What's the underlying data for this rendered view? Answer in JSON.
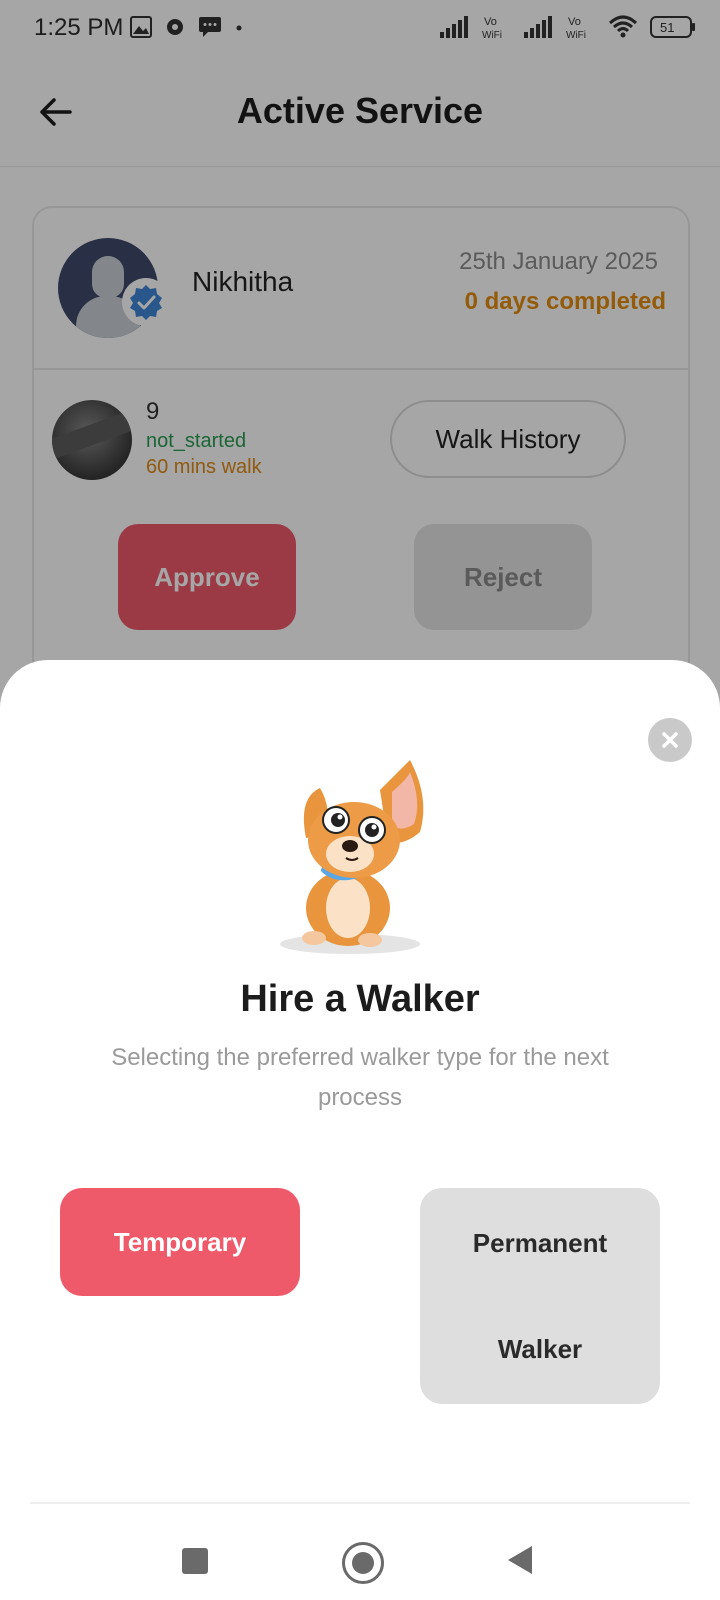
{
  "status_bar": {
    "time": "1:25 PM",
    "icons_left": [
      "photo-icon",
      "settings-icon",
      "message-icon",
      "dot-icon"
    ],
    "icons_right": [
      "signal-icon",
      "vowifi-icon",
      "signal-icon",
      "vowifi-icon",
      "wifi-icon",
      "battery-icon"
    ],
    "battery": "51",
    "vowifi_label_top": "Vo",
    "vowifi_label_bottom": "WiFi"
  },
  "header": {
    "title": "Active Service",
    "back_icon": "arrow-left-icon"
  },
  "service_card": {
    "user_name": "Nikhitha",
    "date": "25th January 2025",
    "days_completed": "0 days completed",
    "pet": {
      "id": "9",
      "status": "not_started",
      "walk_duration": "60 mins walk"
    },
    "walk_history_label": "Walk History",
    "approve_label": "Approve",
    "reject_label": "Reject"
  },
  "sheet": {
    "title": "Hire a Walker",
    "subtitle": "Selecting the preferred walker type for the next process",
    "temporary_label": "Temporary",
    "permanent_label_line1": "Permanent",
    "permanent_label_line2": "Walker",
    "close_icon": "close-icon",
    "illustration": "dog-illustration"
  },
  "colors": {
    "accent": "#ef5a6b",
    "status_green": "#2a9d53",
    "status_orange": "#e48d10",
    "neutral_button": "#dedede"
  },
  "navbar": {
    "buttons": [
      "recents-icon",
      "home-icon",
      "back-icon"
    ]
  }
}
